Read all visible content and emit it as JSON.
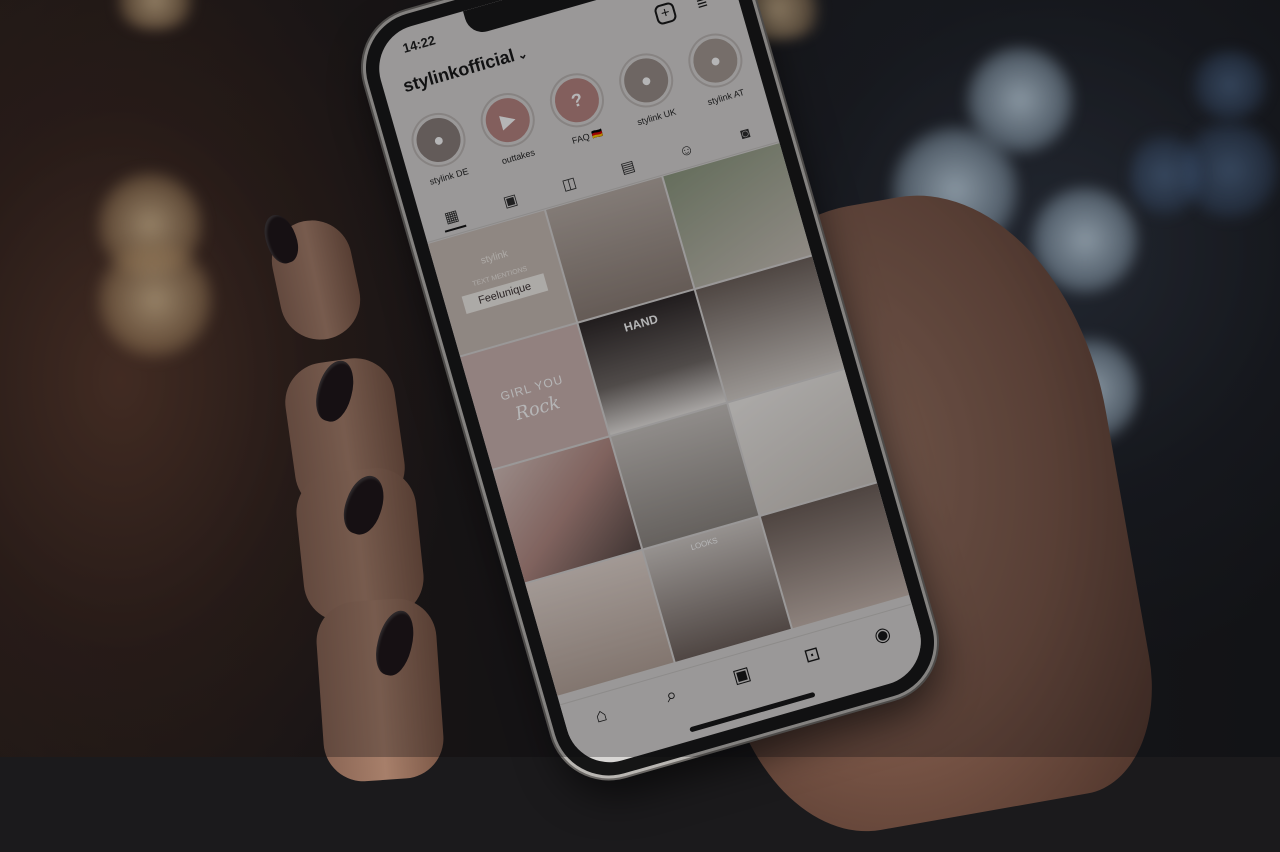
{
  "phone": {
    "status_time": "14:22",
    "username": "stylinkofficial",
    "stories": [
      {
        "label": "stylink DE",
        "icon": "profile-photo",
        "color": "#8a7f7a"
      },
      {
        "label": "outtakes",
        "icon": "play-icon",
        "color": "#b88480"
      },
      {
        "label": "FAQ 🇩🇪",
        "icon": "question-icon",
        "color": "#b88480"
      },
      {
        "label": "stylink UK",
        "icon": "profile-photo",
        "color": "#9a8f88"
      },
      {
        "label": "stylink AT",
        "icon": "profile-photo",
        "color": "#a59a92"
      }
    ],
    "grid_tabs": [
      "grid-icon",
      "reels-icon",
      "igtv-icon",
      "guides-icon",
      "effects-icon",
      "tagged-icon"
    ],
    "grid_posts": [
      {
        "kind": "graphic",
        "line1": "stylink",
        "line2": "TEXT MENTIONS",
        "line3": "Feelunique",
        "bg": "#c9bdb5"
      },
      {
        "kind": "photo",
        "bg": "#a99f98"
      },
      {
        "kind": "photo",
        "bg": "#7d8a6f"
      },
      {
        "kind": "graphic",
        "line1": "GIRL YOU",
        "line2": "Rock",
        "bg": "#cdb5b0"
      },
      {
        "kind": "photo",
        "label": "HAND",
        "bg": "#3a3434"
      },
      {
        "kind": "photo",
        "bg": "#9c8c82"
      },
      {
        "kind": "photo",
        "bg": "#c4a9a4"
      },
      {
        "kind": "photo",
        "bg": "#b8b2ac"
      },
      {
        "kind": "photo",
        "bg": "#e3e0dc"
      },
      {
        "kind": "photo",
        "bg": "#d9cfc8"
      },
      {
        "kind": "photo",
        "label": "LOOKS",
        "bg": "#bdb6b2"
      },
      {
        "kind": "photo",
        "bg": "#8d7f78"
      }
    ],
    "bottom_nav": [
      "home-icon",
      "search-icon",
      "reels-icon",
      "shop-icon",
      "profile-icon"
    ]
  }
}
